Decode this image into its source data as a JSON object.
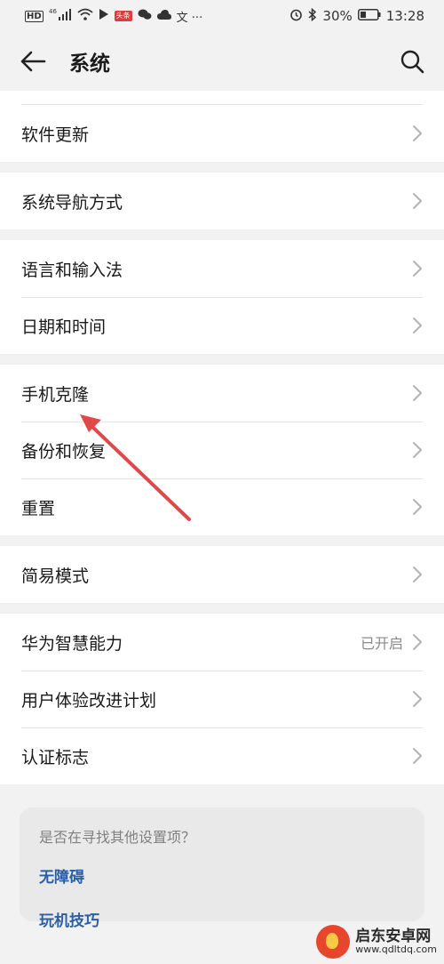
{
  "status_bar": {
    "left_signal": "46",
    "left_hd": "HD",
    "left_badge": "头条",
    "left_misc": "文 ···",
    "battery": "30%",
    "time": "13:28"
  },
  "header": {
    "title": "系统"
  },
  "sections": [
    {
      "items": [
        {
          "label": "软件更新",
          "value": ""
        }
      ]
    },
    {
      "items": [
        {
          "label": "系统导航方式",
          "value": ""
        }
      ]
    },
    {
      "items": [
        {
          "label": "语言和输入法",
          "value": ""
        },
        {
          "label": "日期和时间",
          "value": ""
        }
      ]
    },
    {
      "items": [
        {
          "label": "手机克隆",
          "value": ""
        },
        {
          "label": "备份和恢复",
          "value": ""
        },
        {
          "label": "重置",
          "value": ""
        }
      ]
    },
    {
      "items": [
        {
          "label": "简易模式",
          "value": ""
        }
      ]
    },
    {
      "items": [
        {
          "label": "华为智慧能力",
          "value": "已开启"
        },
        {
          "label": "用户体验改进计划",
          "value": ""
        },
        {
          "label": "认证标志",
          "value": ""
        }
      ]
    }
  ],
  "suggestions": {
    "question": "是否在寻找其他设置项？",
    "links": [
      "无障碍",
      "玩机技巧"
    ]
  },
  "watermark": {
    "name": "启东安卓网",
    "url": "www.qdltdq.com"
  },
  "colors": {
    "arrow": "#e0484a",
    "link": "#2a5ea8",
    "background": "#f2f2f2"
  }
}
